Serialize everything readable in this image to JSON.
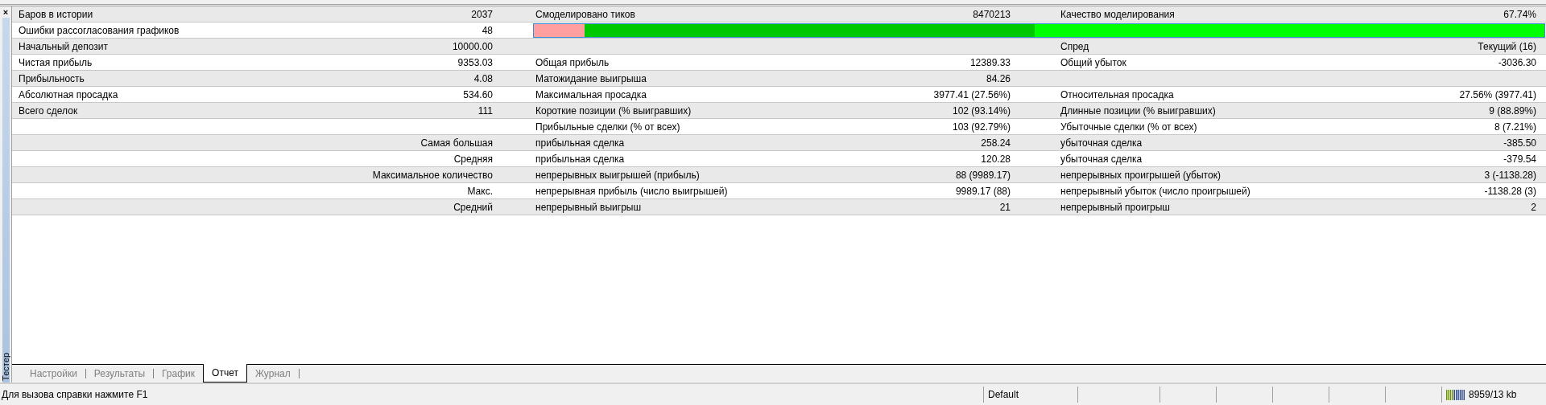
{
  "panel": {
    "close": "×",
    "title": "Тестер"
  },
  "report": {
    "rows": [
      {
        "label": "Баров в истории",
        "value": "2037",
        "label2": "Смоделировано тиков",
        "value2": "8470213",
        "label3": "Качество моделирования",
        "value3": "67.74%"
      },
      {
        "label": "Ошибки рассогласования графиков",
        "value": "48",
        "bar": {
          "color": "#00ff00",
          "fills": [
            {
              "color": "#00c800",
              "level": 0.496
            },
            {
              "color": "#ff9f9f",
              "level": 0.05
            }
          ]
        }
      },
      {
        "label": "Начальный депозит",
        "value": "10000.00",
        "label3": "Спред",
        "value3": "Текущий (16)"
      },
      {
        "label": "Чистая прибыль",
        "value": "9353.03",
        "label2": "Общая прибыль",
        "value2": "12389.33",
        "label3": "Общий убыток",
        "value3": "-3036.30"
      },
      {
        "label": "Прибыльность",
        "value": "4.08",
        "label2": "Матожидание выигрыша",
        "value2": "84.26"
      },
      {
        "label": "Абсолютная просадка",
        "value": "534.60",
        "label2": "Максимальная просадка",
        "value2": "3977.41 (27.56%)",
        "label3": "Относительная просадка",
        "value3": "27.56% (3977.41)"
      },
      {
        "label": "Всего сделок",
        "value": "111",
        "label2": "Короткие позиции (% выигравших)",
        "value2": "102 (93.14%)",
        "label3": "Длинные позиции (% выигравших)",
        "value3": "9 (88.89%)"
      },
      {
        "label2": "Прибыльные сделки (% от всех)",
        "value2": "103 (92.79%)",
        "label3": "Убыточные сделки (% от всех)",
        "value3": "8 (7.21%)"
      },
      {
        "caption": "Самая большая",
        "label2": "прибыльная сделка",
        "value2": "258.24",
        "label3": "убыточная сделка",
        "value3": "-385.50"
      },
      {
        "caption": "Средняя",
        "label2": "прибыльная сделка",
        "value2": "120.28",
        "label3": "убыточная сделка",
        "value3": "-379.54"
      },
      {
        "caption": "Максимальное количество",
        "label2": "непрерывных выигрышей (прибыль)",
        "value2": "88 (9989.17)",
        "label3": "непрерывных проигрышей (убыток)",
        "value3": "3 (-1138.28)"
      },
      {
        "caption": "Макс.",
        "label2": "непрерывная прибыль (число выигрышей)",
        "value2": "9989.17 (88)",
        "label3": "непрерывный убыток (число проигрышей)",
        "value3": "-1138.28 (3)"
      },
      {
        "caption": "Средний",
        "label2": "непрерывный выигрыш",
        "value2": "21",
        "label3": "непрерывный проигрыш",
        "value3": "2"
      }
    ]
  },
  "tabs": [
    {
      "label": "Настройки",
      "selected": false
    },
    {
      "label": "Результаты",
      "selected": false
    },
    {
      "label": "График",
      "selected": false
    },
    {
      "label": "Отчет",
      "selected": true
    },
    {
      "label": "Журнал",
      "selected": false
    }
  ],
  "status_bar": {
    "help": "Для вызова справки нажмите F1",
    "profile": "Default",
    "traffic": "8959/13 kb"
  }
}
